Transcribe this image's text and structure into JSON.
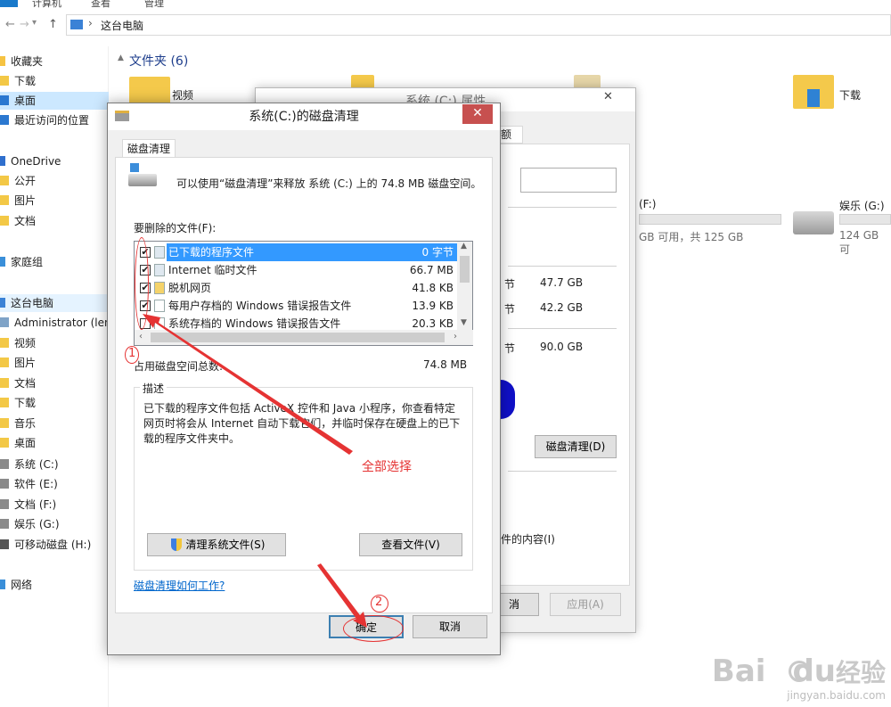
{
  "ribbon": {
    "tabs": [
      "计算机",
      "查看",
      "管理"
    ]
  },
  "address": {
    "path": "这台电脑",
    "back": "←",
    "forward": "→",
    "up": "↑",
    "dropdown": "▾",
    "sep": "›"
  },
  "sidebar": {
    "items": [
      {
        "label": "收藏夹",
        "icon": "star-icon"
      },
      {
        "label": "下载",
        "icon": "folder-icon"
      },
      {
        "label": "桌面",
        "icon": "desktop-icon"
      },
      {
        "label": "最近访问的位置",
        "icon": "recent-icon"
      },
      {
        "label": "OneDrive",
        "icon": "cloud-icon"
      },
      {
        "label": "公开",
        "icon": "folder-icon"
      },
      {
        "label": "图片",
        "icon": "folder-icon"
      },
      {
        "label": "文档",
        "icon": "folder-icon"
      },
      {
        "label": "家庭组",
        "icon": "homegroup-icon"
      },
      {
        "label": "这台电脑",
        "icon": "computer-icon"
      },
      {
        "label": "Administrator (len",
        "icon": "user-icon"
      },
      {
        "label": "视频",
        "icon": "folder-icon"
      },
      {
        "label": "图片",
        "icon": "folder-icon"
      },
      {
        "label": "文档",
        "icon": "folder-icon"
      },
      {
        "label": "下载",
        "icon": "folder-icon"
      },
      {
        "label": "音乐",
        "icon": "folder-icon"
      },
      {
        "label": "桌面",
        "icon": "folder-icon"
      },
      {
        "label": "系统 (C:)",
        "icon": "drive-icon"
      },
      {
        "label": "软件 (E:)",
        "icon": "drive-icon"
      },
      {
        "label": "文档 (F:)",
        "icon": "drive-icon"
      },
      {
        "label": "娱乐 (G:)",
        "icon": "drive-icon"
      },
      {
        "label": "可移动磁盘 (H:)",
        "icon": "usb-icon"
      },
      {
        "label": "网络",
        "icon": "network-icon"
      }
    ]
  },
  "main": {
    "group_title": "文件夹 (6)",
    "folders": [
      "视频",
      "下载"
    ],
    "drive_f": {
      "label": "(F:)",
      "info": "GB 可用，共 125 GB"
    },
    "drive_g": {
      "label": "娱乐 (G:)",
      "info": "124 GB 可"
    }
  },
  "props": {
    "title": "系统 (C:) 属性",
    "tab_fragment": "额",
    "rows": [
      {
        "unit": "节",
        "value": "47.7 GB"
      },
      {
        "unit": "节",
        "value": "42.2 GB"
      },
      {
        "unit": "节",
        "value": "90.0 GB"
      }
    ],
    "cleanup_button": "磁盘清理(D)",
    "content_text": "件的内容(I)",
    "cancel_fragment": "消",
    "apply_button": "应用(A)"
  },
  "dialog": {
    "title": "系统(C:)的磁盘清理",
    "close": "✕",
    "tab": "磁盘清理",
    "intro": "可以使用“磁盘清理”来释放 系统 (C:) 上的 74.8 MB 磁盘空间。",
    "list_label": "要删除的文件(F):",
    "files": [
      {
        "name": "已下载的程序文件",
        "size": "0 字节",
        "checked": true
      },
      {
        "name": "Internet 临时文件",
        "size": "66.7 MB",
        "checked": true
      },
      {
        "name": "脱机网页",
        "size": "41.8 KB",
        "checked": true
      },
      {
        "name": "每用户存档的 Windows 错误报告文件",
        "size": "13.9 KB",
        "checked": true
      },
      {
        "name": "系统存档的 Windows 错误报告文件",
        "size": "20.3 KB",
        "checked": false
      }
    ],
    "total_label": "占用磁盘空间总数:",
    "total_value": "74.8 MB",
    "desc_legend": "描述",
    "description": "已下载的程序文件包括 ActiveX 控件和 Java 小程序，你查看特定网页时将会从 Internet 自动下载它们，并临时保存在硬盘上的已下载的程序文件夹中。",
    "clean_system_button": "清理系统文件(S)",
    "view_files_button": "查看文件(V)",
    "help_link": "磁盘清理如何工作?",
    "ok_button": "确定",
    "cancel_button": "取消"
  },
  "annotations": {
    "step1": "1",
    "step2": "2",
    "select_all": "全部选择"
  },
  "watermark": {
    "brand": "Bai",
    "brand2": "du",
    "cn": "经验",
    "url": "jingyan.baidu.com"
  }
}
